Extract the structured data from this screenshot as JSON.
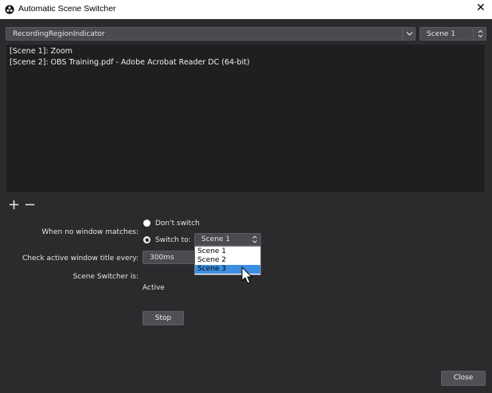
{
  "window": {
    "title": "Automatic Scene Switcher",
    "close_glyph": "✕",
    "app_icon": "obs-logo-icon"
  },
  "top": {
    "window_select_value": "RecordingRegionIndicator",
    "scene_select_value": "Scene 1"
  },
  "list": {
    "items": [
      "[Scene 1]: Zoom",
      "[Scene 2]: OBS Training.pdf - Adobe Acrobat Reader DC (64-bit)"
    ]
  },
  "list_controls": {
    "add": "+",
    "remove": "−"
  },
  "settings": {
    "no_match_label": "When no window matches:",
    "dont_switch_label": "Don't switch",
    "switch_to_label": "Switch to:",
    "switch_to_value": "Scene 1",
    "switch_to_options": [
      "Scene 1",
      "Scene 2",
      "Scene 3"
    ],
    "highlighted_option": "Scene 3",
    "check_interval_label": "Check active window title every:",
    "check_interval_value": "300ms",
    "status_label": "Scene Switcher is:",
    "status_value": "Active"
  },
  "buttons": {
    "stop": "Stop",
    "close": "Close"
  },
  "colors": {
    "background": "#2b2b2e",
    "list_background": "#1f1f22",
    "highlight": "#3d8ee0",
    "titlebar": "#ffffff"
  }
}
